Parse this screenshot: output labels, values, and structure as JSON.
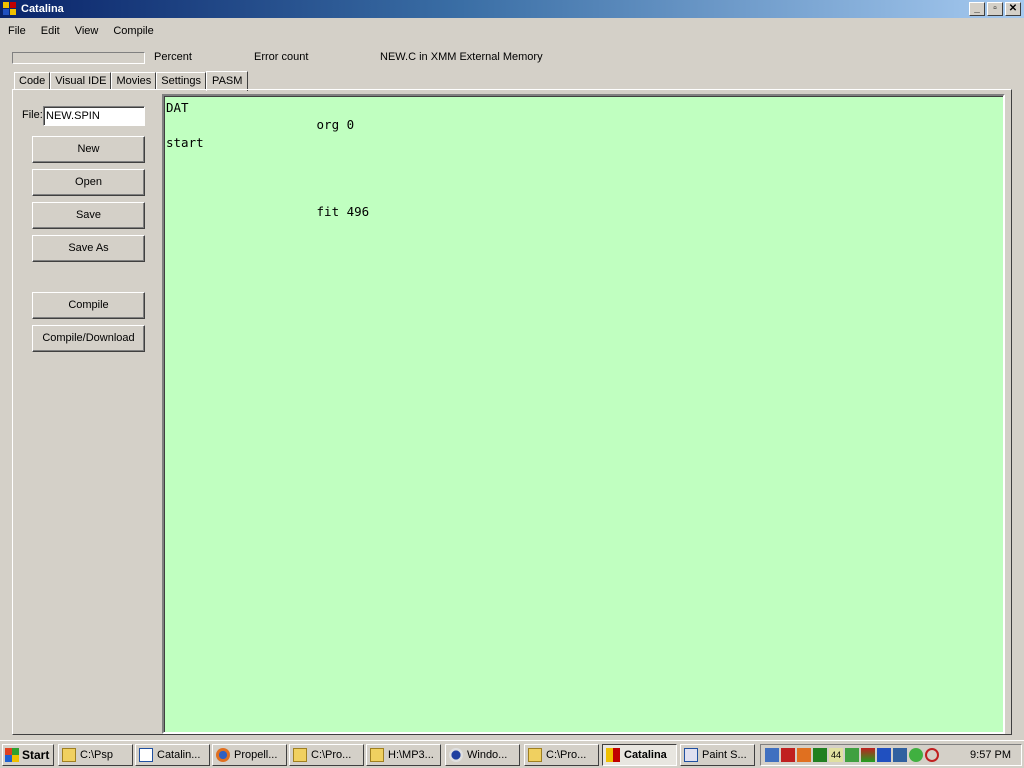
{
  "window": {
    "title": "Catalina",
    "minimize": "_",
    "maximize": "▫",
    "close": "✕"
  },
  "menu": [
    "File",
    "Edit",
    "View",
    "Compile"
  ],
  "status": {
    "percent_label": "Percent",
    "error_label": "Error count",
    "mode_text": "NEW.C in XMM External Memory",
    "progress": 0
  },
  "tabs": [
    {
      "label": "Code",
      "active": false
    },
    {
      "label": "Visual IDE",
      "active": false
    },
    {
      "label": "Movies",
      "active": false
    },
    {
      "label": "Settings",
      "active": false
    },
    {
      "label": "PASM",
      "active": true
    }
  ],
  "file": {
    "label": "File:",
    "value": "NEW.SPIN"
  },
  "buttons": {
    "new": "New",
    "open": "Open",
    "save": "Save",
    "save_as": "Save As",
    "compile": "Compile",
    "compile_download": "Compile/Download"
  },
  "editor": {
    "content": "DAT\n                    org 0\nstart\n\n\n\n                    fit 496",
    "background": "#c0ffc0"
  },
  "taskbar": {
    "start": "Start",
    "tasks": [
      {
        "label": "C:\\Psp",
        "icon": "folder-icon",
        "active": false
      },
      {
        "label": "Catalin...",
        "icon": "vb-icon",
        "active": false
      },
      {
        "label": "Propell...",
        "icon": "firefox-icon",
        "active": false
      },
      {
        "label": "C:\\Pro...",
        "icon": "folder-icon",
        "active": false
      },
      {
        "label": "H:\\MP3...",
        "icon": "folder-icon",
        "active": false
      },
      {
        "label": "Windo...",
        "icon": "media-player-icon",
        "active": false
      },
      {
        "label": "C:\\Pro...",
        "icon": "folder-icon",
        "active": false
      },
      {
        "label": "Catalina",
        "icon": "app-icon",
        "active": true
      },
      {
        "label": "Paint S...",
        "icon": "paint-icon",
        "active": false
      }
    ],
    "tray_badge": "44",
    "clock": "9:57 PM"
  }
}
